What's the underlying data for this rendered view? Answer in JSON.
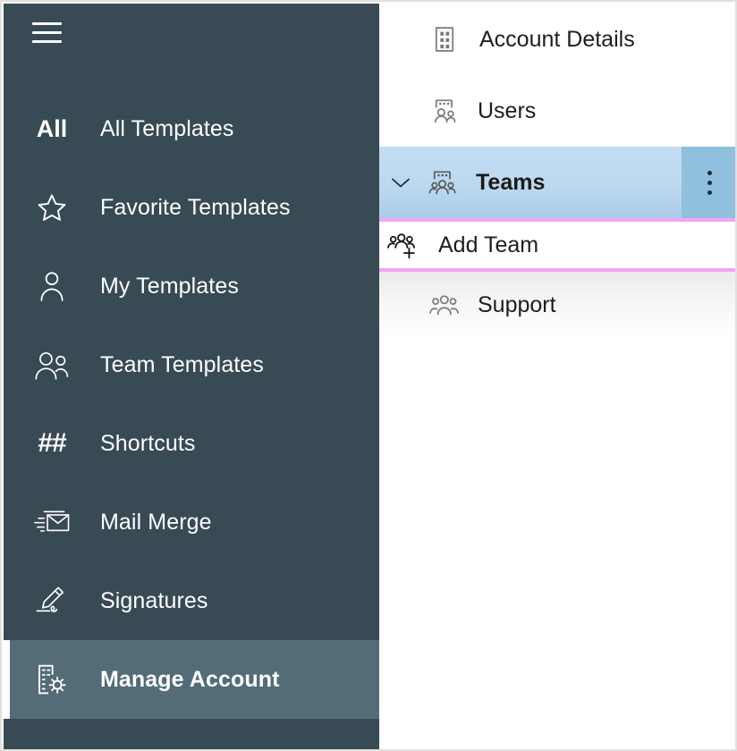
{
  "app": {
    "menu_button": "Main menu",
    "accent_highlight": "#f2a4f5",
    "sidebar_bg": "#384a53",
    "sidebar_active_bg": "#536c77",
    "panel_selected_bg": "#bcd8ef",
    "panel_kebab_bg": "#8fc0de"
  },
  "sidebar": {
    "items": [
      {
        "label": "All Templates",
        "icon": "all-text-icon",
        "glyph": "All",
        "active": false
      },
      {
        "label": "Favorite Templates",
        "icon": "star-icon",
        "glyph": "",
        "active": false
      },
      {
        "label": "My Templates",
        "icon": "person-icon",
        "glyph": "",
        "active": false
      },
      {
        "label": "Team Templates",
        "icon": "people-icon",
        "glyph": "",
        "active": false
      },
      {
        "label": "Shortcuts",
        "icon": "hash-icon",
        "glyph": "##",
        "active": false
      },
      {
        "label": "Mail Merge",
        "icon": "mail-merge-icon",
        "glyph": "",
        "active": false
      },
      {
        "label": "Signatures",
        "icon": "pen-signature-icon",
        "glyph": "",
        "active": false
      },
      {
        "label": "Manage Account",
        "icon": "building-gear-icon",
        "glyph": "",
        "active": true
      }
    ]
  },
  "panel": {
    "items": [
      {
        "label": "Account Details",
        "icon": "building-icon"
      },
      {
        "label": "Users",
        "icon": "users-board-icon"
      },
      {
        "label": "Teams",
        "icon": "teams-board-icon",
        "expanded": true,
        "kebab": "more-options"
      },
      {
        "label": "Add Team",
        "icon": "add-team-icon",
        "highlighted": true
      },
      {
        "label": "Support",
        "icon": "people-icon"
      }
    ]
  }
}
